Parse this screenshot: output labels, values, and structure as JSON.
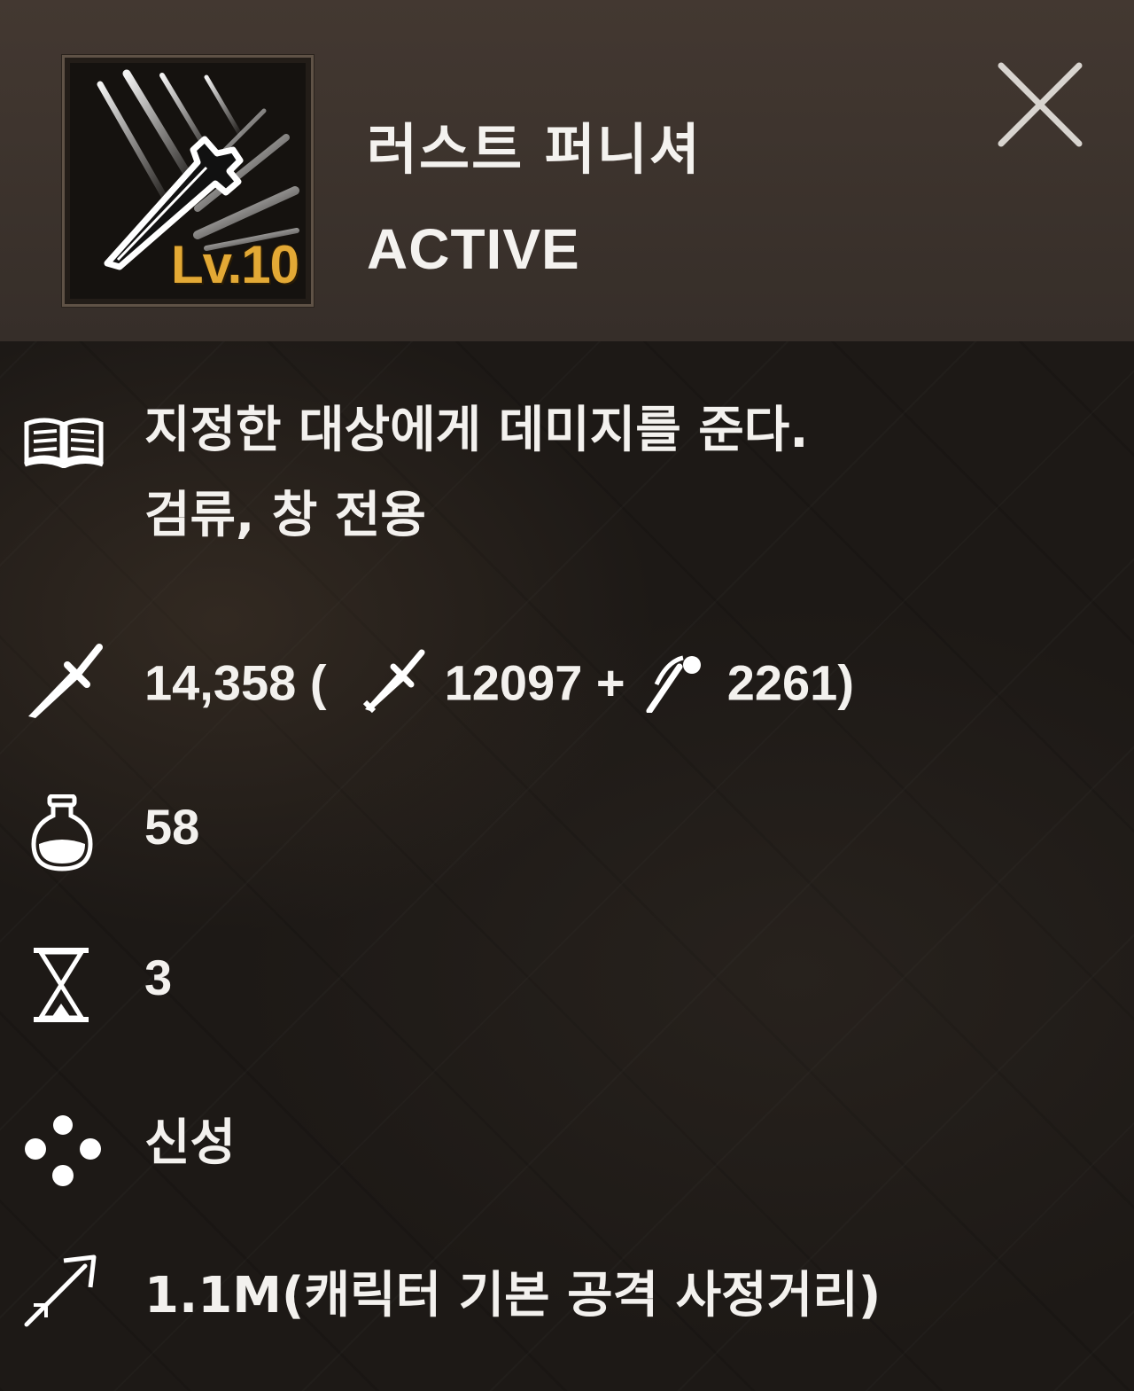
{
  "skill": {
    "name": "러스트 퍼니셔",
    "type": "ACTIVE",
    "level": "Lv.10",
    "icon": "sword-slash-skill-icon",
    "accent_color": "#e3a935"
  },
  "close": {
    "icon": "close-icon"
  },
  "description": {
    "icon": "book-icon",
    "line1": "지정한 대상에게 데미지를 준다.",
    "line2": "검류, 창 전용"
  },
  "damage": {
    "icon": "sword-icon",
    "total": "14,358 (",
    "physical_icon": "sword-icon",
    "physical": "12097 +",
    "magic_icon": "magic-wand-icon",
    "magic": "2261)"
  },
  "mana_cost": {
    "icon": "potion-icon",
    "value": "58"
  },
  "cooldown": {
    "icon": "hourglass-icon",
    "value": "3"
  },
  "element": {
    "icon": "orbs-icon",
    "value": "신성"
  },
  "range": {
    "icon": "arrow-icon",
    "value": "1.1M(캐릭터 기본 공격 사정거리)"
  }
}
